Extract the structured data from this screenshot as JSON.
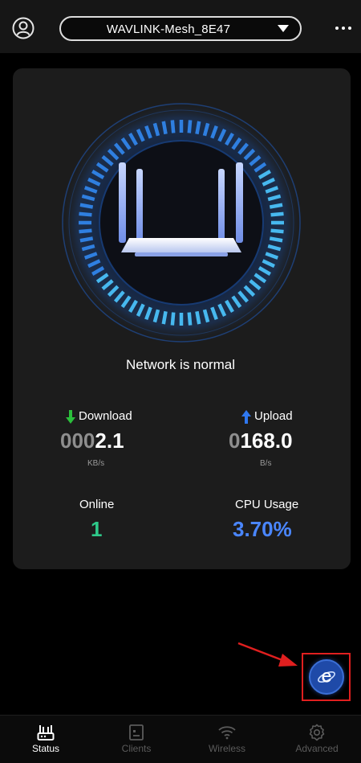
{
  "header": {
    "ssid": "WAVLINK-Mesh_8E47"
  },
  "status": {
    "message": "Network is normal"
  },
  "download": {
    "label": "Download",
    "value_dim": "000",
    "value_main": "2.1",
    "unit": "KB/s"
  },
  "upload": {
    "label": "Upload",
    "value_dim": "0",
    "value_main": "168.0",
    "unit": "B/s"
  },
  "online": {
    "label": "Online",
    "value": "1"
  },
  "cpu": {
    "label": "CPU Usage",
    "value": "3.70%"
  },
  "tabs": [
    {
      "label": "Status",
      "icon": "router-icon",
      "active": true
    },
    {
      "label": "Clients",
      "icon": "clients-icon",
      "active": false
    },
    {
      "label": "Wireless",
      "icon": "wifi-icon",
      "active": false
    },
    {
      "label": "Advanced",
      "icon": "gear-icon",
      "active": false
    }
  ],
  "colors": {
    "accent_blue": "#4a86ff",
    "online_green": "#2ec98a",
    "download_arrow": "#2bbf3c",
    "upload_arrow": "#2f78f0",
    "highlight_red": "#e01f1f"
  }
}
